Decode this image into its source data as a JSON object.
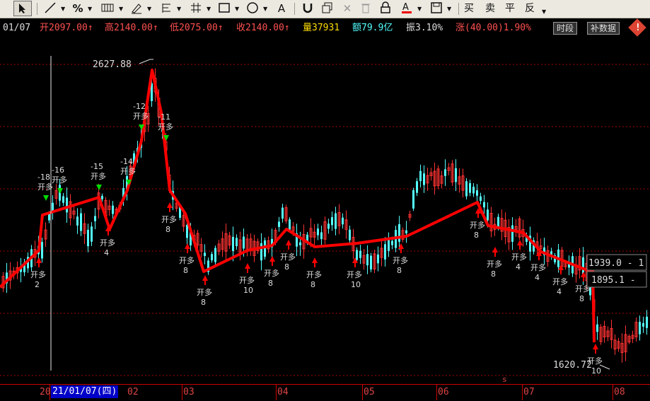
{
  "toolbar": {
    "tools": [
      "cursor-tool",
      "line-tool",
      "percent-tool",
      "channel-tool",
      "pen-tool",
      "fib-tool",
      "grid-tool",
      "rect-tool",
      "circle-tool",
      "text-tool",
      "magnet-tool",
      "copy-tool",
      "delete-tool",
      "trash-tool",
      "lock-tool",
      "color-tool",
      "save-tool"
    ],
    "percent_label": "%",
    "text_label": "A",
    "delete_label": "✕",
    "buy_label": "买",
    "sell_label": "卖",
    "flat_label": "平",
    "reverse_label": "反"
  },
  "info": {
    "date": "01/07",
    "open_label": "开",
    "open": "2097.00",
    "high_label": "高",
    "high": "2140.00",
    "low_label": "低",
    "low": "2075.00",
    "close_label": "收",
    "close": "2140.00",
    "vol_label": "量",
    "volume": "37931",
    "amount_label": "额",
    "amount": "79.9亿",
    "amp_label": "振",
    "amplitude": "3.10%",
    "chg_label": "涨",
    "change": "(40.00)1.90%",
    "btn_period": "时段",
    "btn_fill": "补数据"
  },
  "chart_data": {
    "type": "candlestick",
    "x_labels": [
      "20",
      "02",
      "03",
      "04",
      "05",
      "06",
      "07",
      "08"
    ],
    "cursor_date": "21/01/07(四)",
    "high_label": "2627.88",
    "low_label": "1620.72",
    "price_labels": [
      "1939.0 - 1",
      "1895.1 -"
    ],
    "signal_label": "开多",
    "down_marks": [
      "-18",
      "-16",
      "-15",
      "-14",
      "-12",
      "-11"
    ],
    "up_marks": [
      "2",
      "4",
      "8",
      "8",
      "8",
      "10",
      "8",
      "8",
      "8",
      "10",
      "8",
      "8",
      "8",
      "4",
      "4",
      "4",
      "8",
      "10",
      "10",
      "10"
    ],
    "colors": {
      "up": "#ff3232",
      "down": "#54ffff",
      "trend": "#ff0000",
      "grid": "#a00000",
      "arrow_up": "#ff0000",
      "arrow_down": "#00dd00"
    }
  },
  "xaxis": {
    "small_s": "s"
  }
}
